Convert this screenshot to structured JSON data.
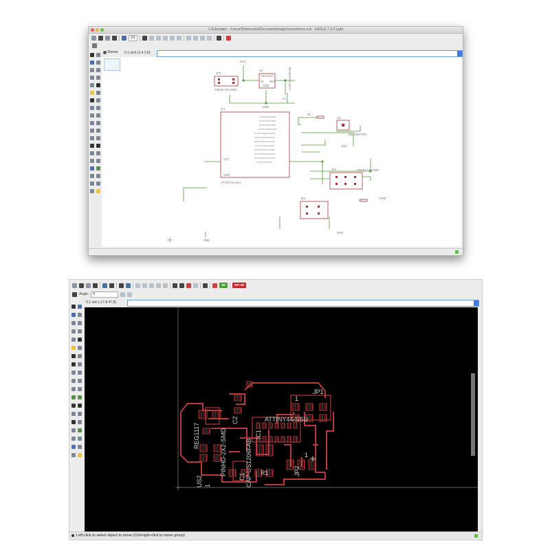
{
  "top_window": {
    "title": "1 Schematic - /Users/Shinnosuke/Documents/eagle/servo/servo.sch - EAGLE 7.3.0 Light",
    "zoom_select": "1/1",
    "coordinate": "0.1 inch (2.4 2.6)",
    "sheet_tab": "Sheets",
    "labels": {
      "vcc_top": "VCC",
      "jp3_name": "JP3",
      "jp3_value": "PINHD-2X2-SMD",
      "u2_name": "U2",
      "u2_value": "REG1117",
      "u2_in": "IN",
      "u2_out": "OUT",
      "u2_gnd": "GND",
      "c1_name": "C1",
      "c1_value": "CAP-US1206FAB",
      "gnd_top": "GND",
      "r2": "R2",
      "r1": "R1",
      "u3_name": "U3",
      "u3_value": "RESONATOR",
      "ic1_name": "IC1",
      "ic1_value": "ATTINY44-SSU",
      "ic1_vcc": "VCC",
      "ic1_gnd": "GND",
      "jp1_name": "JP1",
      "jp1_value": "PINHD-2X3-SMD",
      "jp2_name": "JP2",
      "pwm_label": "PWM",
      "gnd_mid": "GND",
      "gnd_bottom": "GND",
      "gnd_left": "GND"
    },
    "ic1_pins_left": [
      "(PCINT0/AREF/ADC0)PA0",
      "(PCINT1/AIN0/ADC1)PA1",
      "(PCINT2/AIN1/ADC2)PA2",
      "(PCINT3/T0/ADC3)PA3",
      "(PCINT4/SCK/ADC4)PA4",
      "(PCINT5/MISO/ADC5)PA5",
      "(PCINT6/MOSI/ADC6)PA6",
      "(PCINT7/ADC7)PA7"
    ],
    "ic1_pins_right": [
      "(PCINT8/XTAL1)PB0",
      "(PCINT9/XTAL2)PB1",
      "(PCINT10/INT0)PB2",
      "(PCINT11/RESET)PB3"
    ]
  },
  "bottom_window": {
    "angle_label": "Angle:",
    "angle_value": "0",
    "coordinate": "0.1 mm (-17.8 47.8)",
    "badge_red": "IDF-3D",
    "badge_green": "3D",
    "status_message": "Left-click to select object to move (Ctrl+right-click to move group)",
    "board_labels": {
      "reg": "REG1117",
      "pinhd": "PINHD-2X2-SMD",
      "us2": "US2",
      "one_a": "1",
      "c2": "C2",
      "cap": "CAP-US1206FAB",
      "ic1": "IC1",
      "attiny": "ATTINY44-SSU",
      "jp1": "JP1",
      "one_b": "1",
      "jp2": "JP2",
      "one_c": "1",
      "r1": "R1",
      "c1": "C1"
    }
  },
  "colors": {
    "board_red": "#b83a3a",
    "wire_green": "#4d9a3a",
    "symbol_red": "#a83232",
    "cmd_blue": "#3d7be2"
  }
}
